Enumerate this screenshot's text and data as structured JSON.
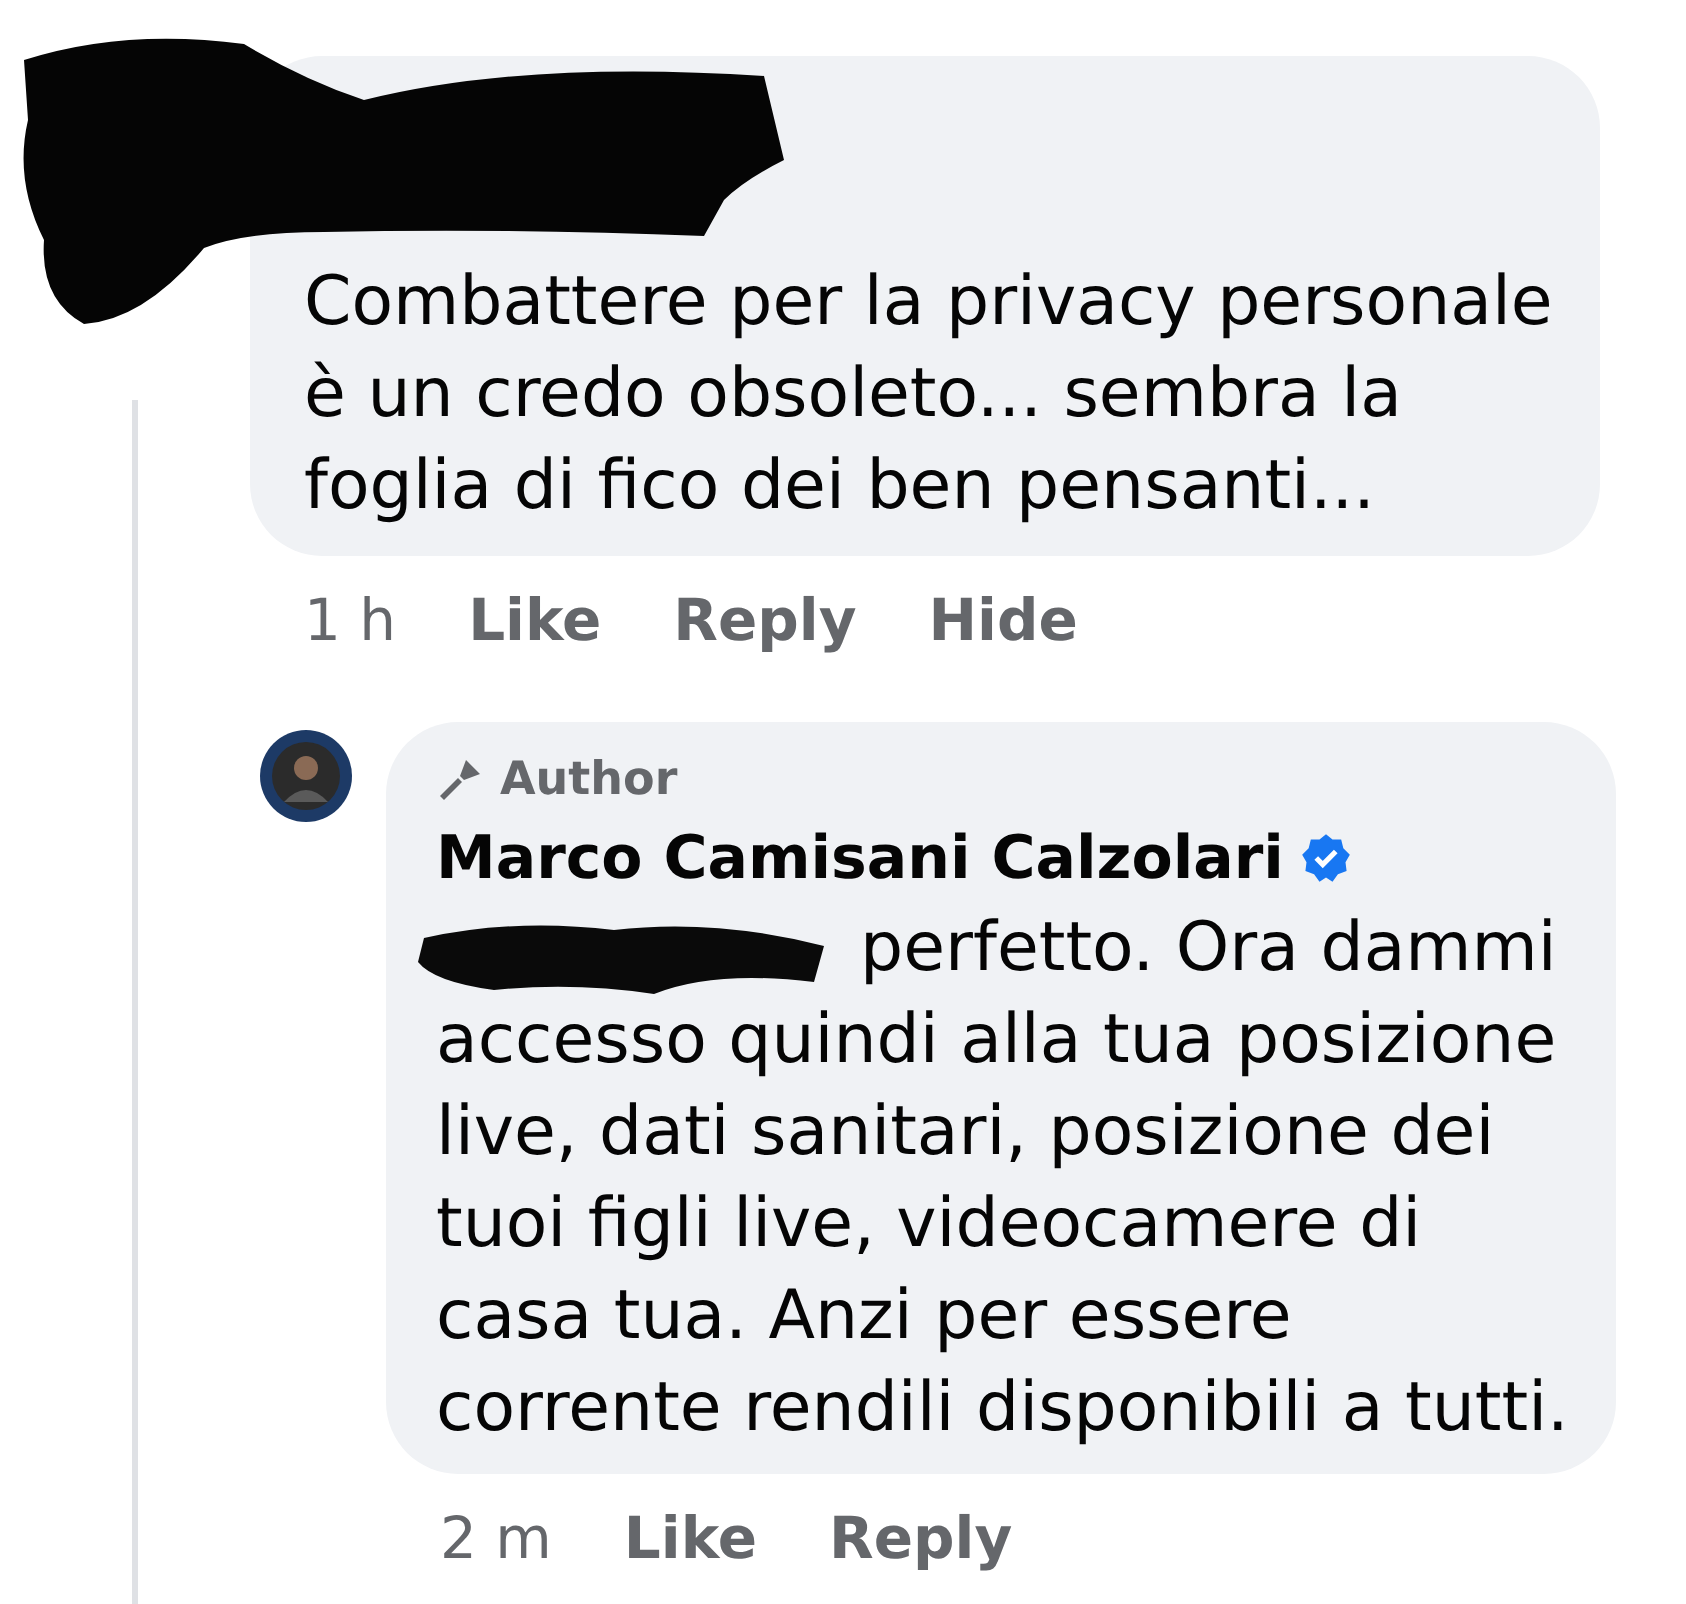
{
  "comments": [
    {
      "kind": "comment",
      "text": "Combattere per la privacy personale è un credo obsoleto... sembra la foglia di fico dei ben pensanti...",
      "time": "1 h",
      "actions": [
        "Like",
        "Reply",
        "Hide"
      ]
    },
    {
      "kind": "reply",
      "author_badge": "Author",
      "name": "Marco Camisani Calzolari",
      "verified": true,
      "redacted_mention": true,
      "text": "perfetto. Ora dammi accesso quindi alla tua posizione live, dati sanitari, posizione dei tuoi figli live, videocamere di casa tua. Anzi per essere corrente rendili disponibili a tutti.",
      "time": "2 m",
      "actions": [
        "Like",
        "Reply"
      ]
    }
  ]
}
